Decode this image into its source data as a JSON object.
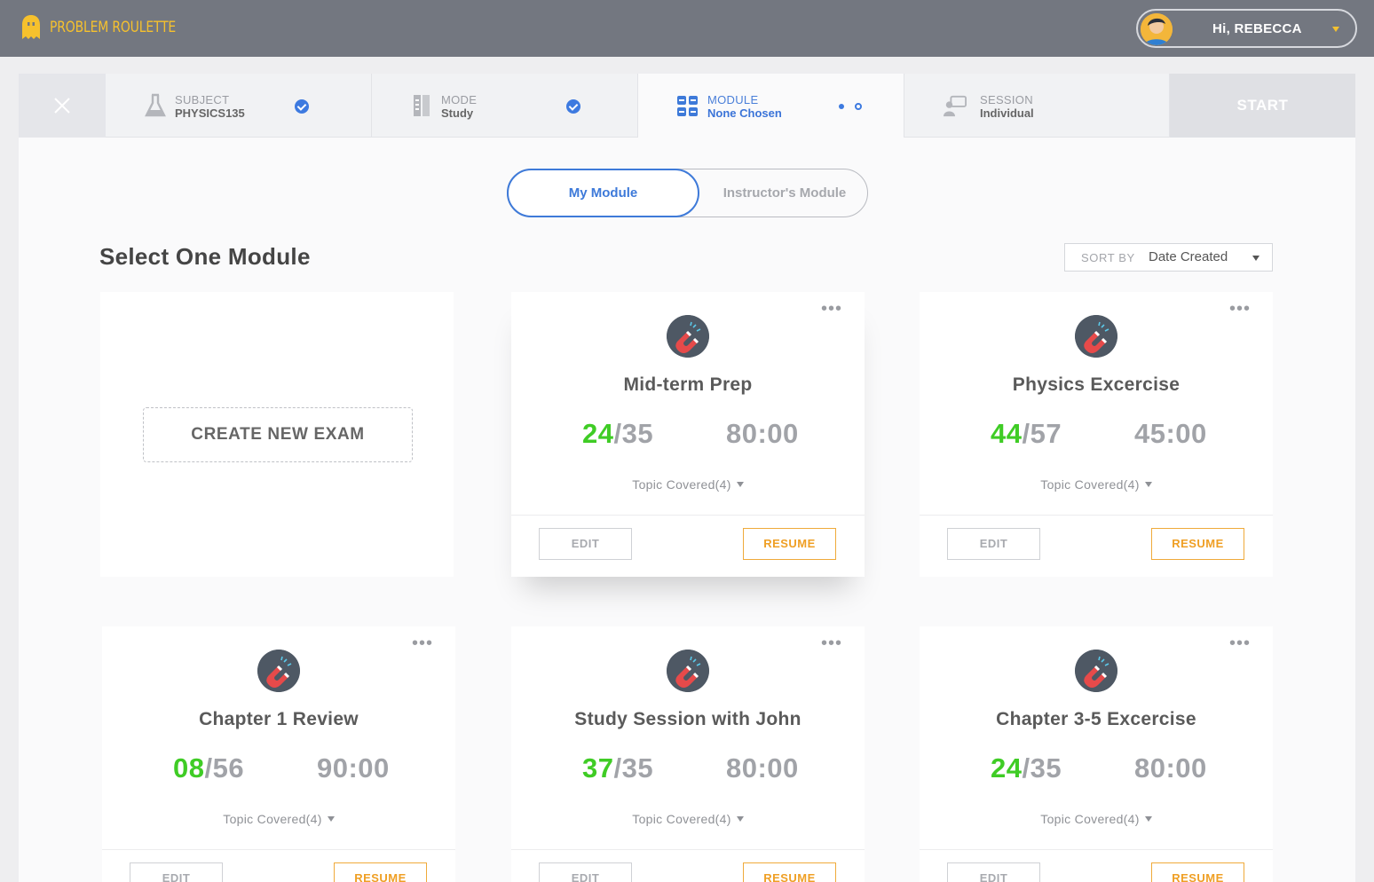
{
  "app": {
    "name": "PROBLEM ROULETTE"
  },
  "user": {
    "greeting": "Hi, REBECCA"
  },
  "colors": {
    "accent": "#3d7ae0",
    "success": "#3fcc25",
    "resume": "#ef9f24",
    "logo": "#f6c12d"
  },
  "steps": [
    {
      "label": "SUBJECT",
      "value": "PHYSICS135",
      "icon": "flask-icon",
      "status": "complete"
    },
    {
      "label": "MODE",
      "value": "Study",
      "icon": "book-icon",
      "status": "complete"
    },
    {
      "label": "MODULE",
      "value": "None Chosen",
      "icon": "grid-icon",
      "status": "active"
    },
    {
      "label": "SESSION",
      "value": "Individual",
      "icon": "chat-icon",
      "status": "pending"
    }
  ],
  "start_label": "START",
  "toggle": {
    "mine": "My Module",
    "instructor": "Instructor's Module"
  },
  "section_title": "Select One Module",
  "sort": {
    "label": "SORT BY",
    "value": "Date Created"
  },
  "create_label": "CREATE NEW EXAM",
  "card_buttons": {
    "edit": "EDIT",
    "resume": "RESUME"
  },
  "modules": [
    {
      "title": "Mid-term Prep",
      "done": "24",
      "total": "/35",
      "time": "80:00",
      "topics": "Topic Covered(4)"
    },
    {
      "title": "Physics Excercise",
      "done": "44",
      "total": "/57",
      "time": "45:00",
      "topics": "Topic Covered(4)"
    },
    {
      "title": "Chapter 1 Review",
      "done": "08",
      "total": "/56",
      "time": "90:00",
      "topics": "Topic Covered(4)"
    },
    {
      "title": "Study Session with John",
      "done": "37",
      "total": "/35",
      "time": "80:00",
      "topics": "Topic Covered(4)"
    },
    {
      "title": "Chapter 3-5 Excercise",
      "done": "24",
      "total": "/35",
      "time": "80:00",
      "topics": "Topic Covered(4)"
    }
  ]
}
